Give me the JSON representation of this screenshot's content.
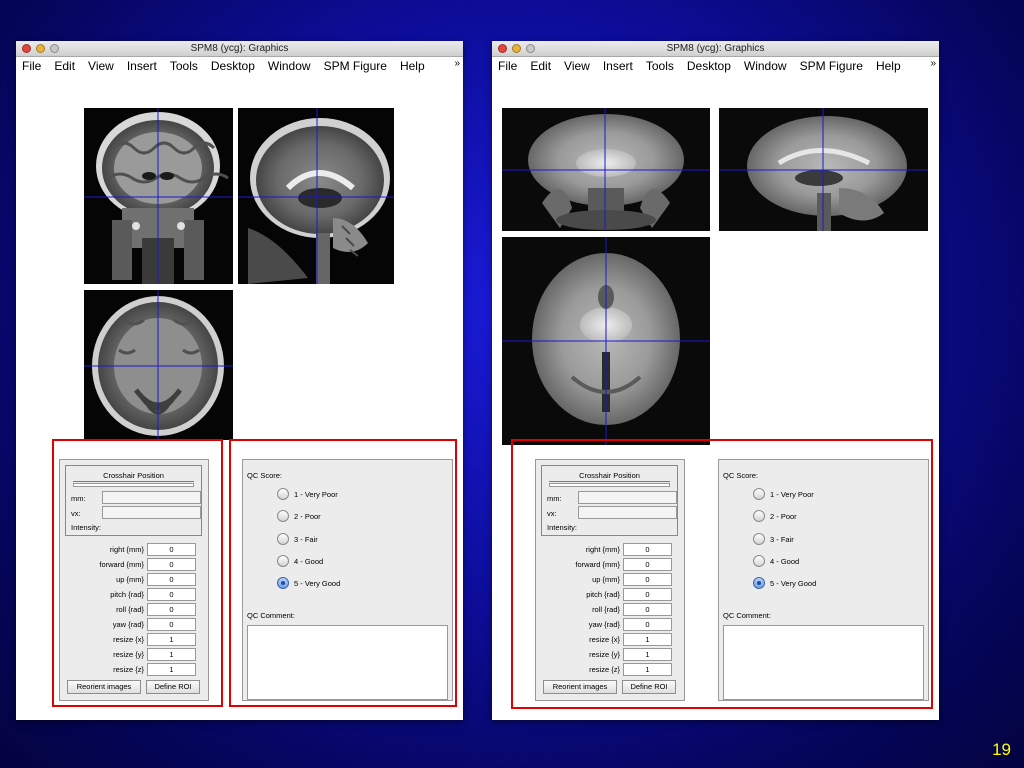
{
  "windows": [
    {
      "title": "SPM8 (ycg): Graphics",
      "menu": [
        "File",
        "Edit",
        "View",
        "Insert",
        "Tools",
        "Desktop",
        "Window",
        "SPM Figure",
        "Help"
      ],
      "crosshair": {
        "title": "Crosshair Position",
        "mm_label": "mm:",
        "vx_label": "vx:",
        "intensity_label": "Intensity:"
      },
      "params": [
        {
          "label": "right  {mm}",
          "value": "0"
        },
        {
          "label": "forward  {mm}",
          "value": "0"
        },
        {
          "label": "up  {mm}",
          "value": "0"
        },
        {
          "label": "pitch  {rad}",
          "value": "0"
        },
        {
          "label": "roll  {rad}",
          "value": "0"
        },
        {
          "label": "yaw  {rad}",
          "value": "0"
        },
        {
          "label": "resize  {x}",
          "value": "1"
        },
        {
          "label": "resize  {y}",
          "value": "1"
        },
        {
          "label": "resize  {z}",
          "value": "1"
        }
      ],
      "buttons": {
        "reorient": "Reorient images",
        "define_roi": "Define ROI"
      },
      "qc": {
        "score_label": "QC Score:",
        "options": [
          "1 - Very Poor",
          "2 - Poor",
          "3 - Fair",
          "4 - Good",
          "5 - Very Good"
        ],
        "selected_index": 4,
        "comment_label": "QC Comment:",
        "comment_value": ""
      }
    },
    {
      "title": "SPM8 (ycg): Graphics",
      "menu": [
        "File",
        "Edit",
        "View",
        "Insert",
        "Tools",
        "Desktop",
        "Window",
        "SPM Figure",
        "Help"
      ],
      "crosshair": {
        "title": "Crosshair Position",
        "mm_label": "mm:",
        "vx_label": "vx:",
        "intensity_label": "Intensity:"
      },
      "params": [
        {
          "label": "right  {mm}",
          "value": "0"
        },
        {
          "label": "forward  {mm}",
          "value": "0"
        },
        {
          "label": "up  {mm}",
          "value": "0"
        },
        {
          "label": "pitch  {rad}",
          "value": "0"
        },
        {
          "label": "roll  {rad}",
          "value": "0"
        },
        {
          "label": "yaw  {rad}",
          "value": "0"
        },
        {
          "label": "resize  {x}",
          "value": "1"
        },
        {
          "label": "resize  {y}",
          "value": "1"
        },
        {
          "label": "resize  {z}",
          "value": "1"
        }
      ],
      "buttons": {
        "reorient": "Reorient images",
        "define_roi": "Define ROI"
      },
      "qc": {
        "score_label": "QC Score:",
        "options": [
          "1 - Very Poor",
          "2 - Poor",
          "3 - Fair",
          "4 - Good",
          "5 - Very Good"
        ],
        "selected_index": 4,
        "comment_label": "QC Comment:",
        "comment_value": ""
      }
    }
  ],
  "slide_number": "19",
  "colors": {
    "highlight_box": "#e00000",
    "crosshair": "#1a1ad0",
    "slide_number": "#ffff00"
  }
}
